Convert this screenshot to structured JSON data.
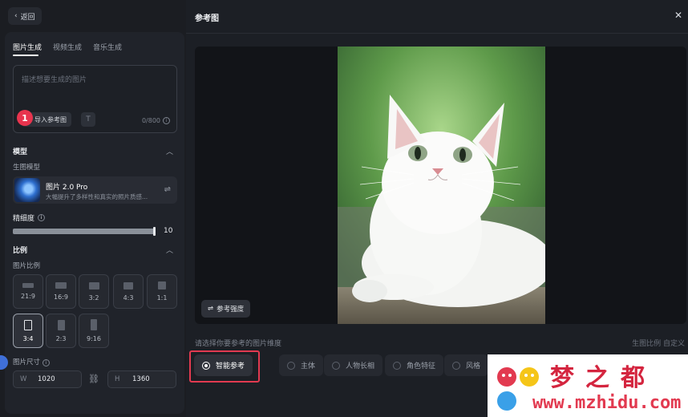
{
  "back": {
    "label": "返回"
  },
  "tabs": [
    {
      "label": "图片生成",
      "active": true
    },
    {
      "label": "视频生成",
      "active": false
    },
    {
      "label": "音乐生成",
      "active": false
    }
  ],
  "prompt": {
    "placeholder": "描述想要生成的图片",
    "upload_label": "导入参考图",
    "char_count": "0/800",
    "badge": "1"
  },
  "model_section": {
    "title": "模型",
    "sublabel": "生图模型",
    "model_name": "图片 2.0 Pro",
    "model_desc": "大幅提升了多样性和真实的照片质感..."
  },
  "precision": {
    "label": "精细度",
    "value": "10",
    "level": 1.0
  },
  "ratio_section": {
    "title": "比例",
    "sublabel": "图片比例",
    "options": [
      {
        "label": "21:9"
      },
      {
        "label": "16:9"
      },
      {
        "label": "3:2"
      },
      {
        "label": "4:3"
      },
      {
        "label": "1:1"
      },
      {
        "label": "3:4",
        "selected": true
      },
      {
        "label": "2:3"
      },
      {
        "label": "9:16"
      }
    ]
  },
  "size_section": {
    "sublabel": "图片尺寸",
    "w_prefix": "W",
    "w_value": "1020",
    "h_prefix": "H",
    "h_value": "1360"
  },
  "modal": {
    "title": "参考图",
    "ref_strength": "参考强度",
    "choose_label": "请选择你要参考的图片维度",
    "ratio_custom": "生图比例 自定义",
    "options": [
      {
        "label": "智能参考",
        "selected": true
      },
      {
        "label": "主体"
      },
      {
        "label": "人物长相"
      },
      {
        "label": "角色特征"
      },
      {
        "label": "风格"
      }
    ]
  },
  "watermark": {
    "title": "梦之都",
    "url": "www.mzhidu.com"
  },
  "colors": {
    "accent_red": "#e23a50",
    "bg_dark": "#16181d"
  }
}
